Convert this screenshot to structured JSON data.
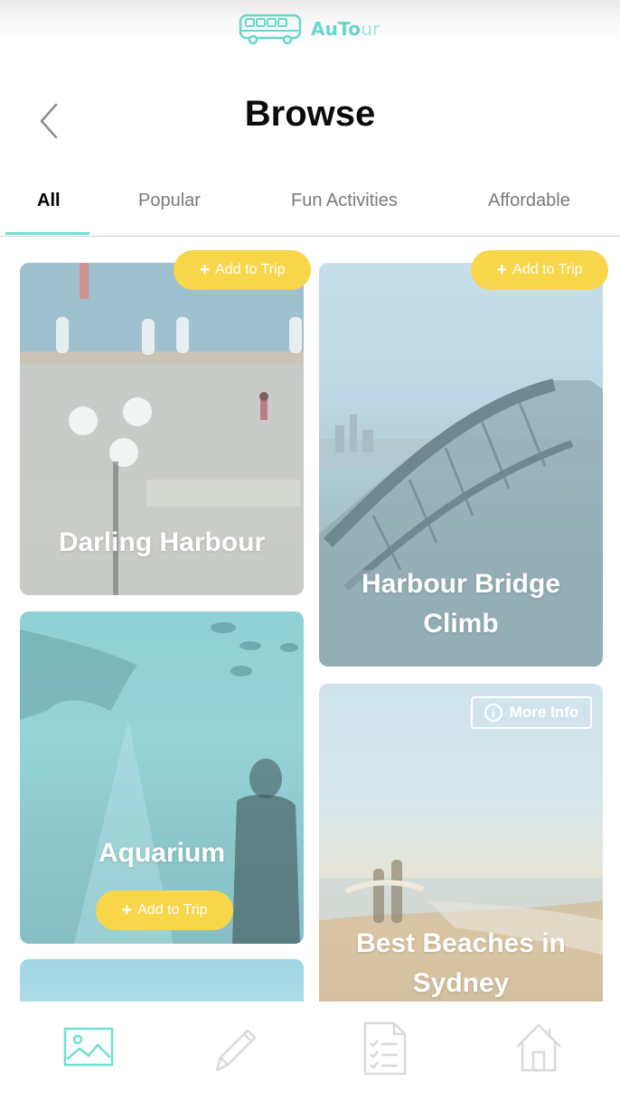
{
  "app": {
    "logo_text_a": "Au",
    "logo_text_b": "To",
    "logo_text_c": "ur",
    "accent": "#63d9c8"
  },
  "header": {
    "title": "Browse",
    "back_icon": "chevron-left-icon"
  },
  "tabs": [
    {
      "label": "All",
      "active": true
    },
    {
      "label": "Popular",
      "active": false
    },
    {
      "label": "Fun Activities",
      "active": false
    },
    {
      "label": "Affordable",
      "active": false
    }
  ],
  "cards": [
    {
      "name": "Darling Harbour",
      "add_label": "Add to Trip"
    },
    {
      "name": "Harbour Bridge Climb",
      "name_line1": "Harbour Bridge",
      "name_line2": "Climb",
      "add_label": "Add to Trip"
    },
    {
      "name": "Aquarium",
      "add_label": "Add to Trip"
    },
    {
      "name": "Best Beaches in Sydney",
      "name_line1": "Best Beaches in",
      "name_line2": "Sydney",
      "more_info_label": "More Info"
    }
  ],
  "bottom_nav": [
    {
      "icon": "gallery-icon",
      "active": true
    },
    {
      "icon": "pencil-icon",
      "active": false
    },
    {
      "icon": "checklist-icon",
      "active": false
    },
    {
      "icon": "home-icon",
      "active": false
    }
  ],
  "colors": {
    "add_button": "#f7d64a",
    "tab_underline": "#6fe0d2",
    "nav_active": "#6fe0d2",
    "nav_inactive": "#d9d9d9"
  }
}
